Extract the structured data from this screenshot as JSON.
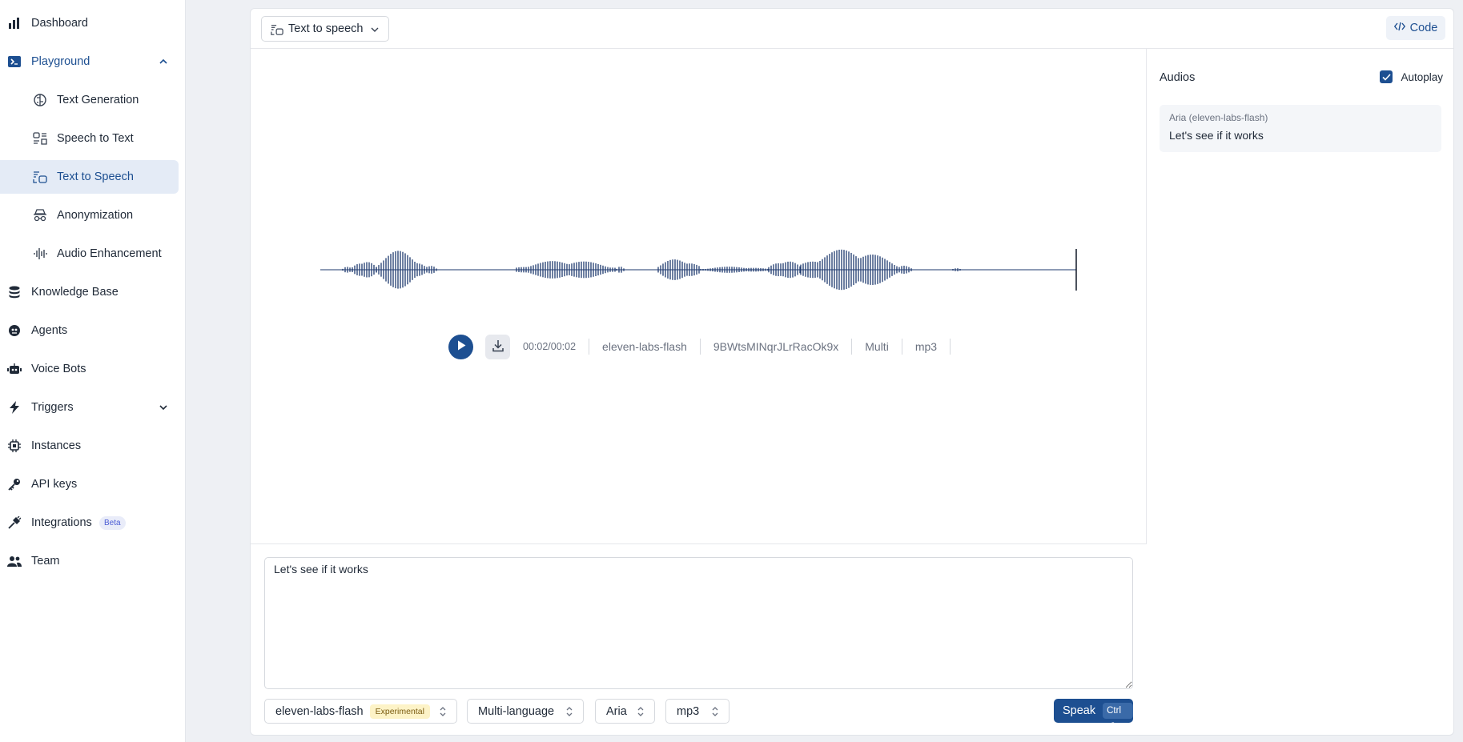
{
  "sidebar": {
    "items": [
      {
        "label": "Dashboard",
        "icon": "bar-chart-icon"
      },
      {
        "label": "Playground",
        "icon": "terminal-icon"
      },
      {
        "label": "Text Generation",
        "icon": "brain-icon"
      },
      {
        "label": "Speech to Text",
        "icon": "speech-to-text-icon"
      },
      {
        "label": "Text to Speech",
        "icon": "text-to-speech-icon"
      },
      {
        "label": "Anonymization",
        "icon": "incognito-icon"
      },
      {
        "label": "Audio Enhancement",
        "icon": "audio-lines-icon"
      },
      {
        "label": "Knowledge Base",
        "icon": "database-icon"
      },
      {
        "label": "Agents",
        "icon": "agent-icon"
      },
      {
        "label": "Voice Bots",
        "icon": "bot-icon"
      },
      {
        "label": "Triggers",
        "icon": "lightning-icon"
      },
      {
        "label": "Instances",
        "icon": "chip-icon"
      },
      {
        "label": "API keys",
        "icon": "key-icon"
      },
      {
        "label": "Integrations",
        "icon": "plug-icon",
        "badge": "Beta"
      },
      {
        "label": "Team",
        "icon": "users-icon"
      }
    ]
  },
  "header": {
    "mode_label": "Text to speech",
    "code_label": "Code"
  },
  "player": {
    "time": "00:02/00:02",
    "model": "eleven-labs-flash",
    "voice_id": "9BWtsMINqrJLrRacOk9x",
    "language": "Multi",
    "format": "mp3"
  },
  "audios": {
    "title": "Audios",
    "autoplay_label": "Autoplay",
    "autoplay_checked": true,
    "items": [
      {
        "caption": "Aria (eleven-labs-flash)",
        "text": "Let's see if it works"
      }
    ]
  },
  "composer": {
    "text": "Let's see if it works",
    "model": "eleven-labs-flash",
    "model_badge": "Experimental",
    "language": "Multi-language",
    "voice": "Aria",
    "format": "mp3",
    "speak_label": "Speak",
    "shortcut": "Ctrl ⏎"
  },
  "colors": {
    "accent": "#1d4f91",
    "selected_bg": "#e4ebf6",
    "waveform": "#1e3a6e"
  }
}
